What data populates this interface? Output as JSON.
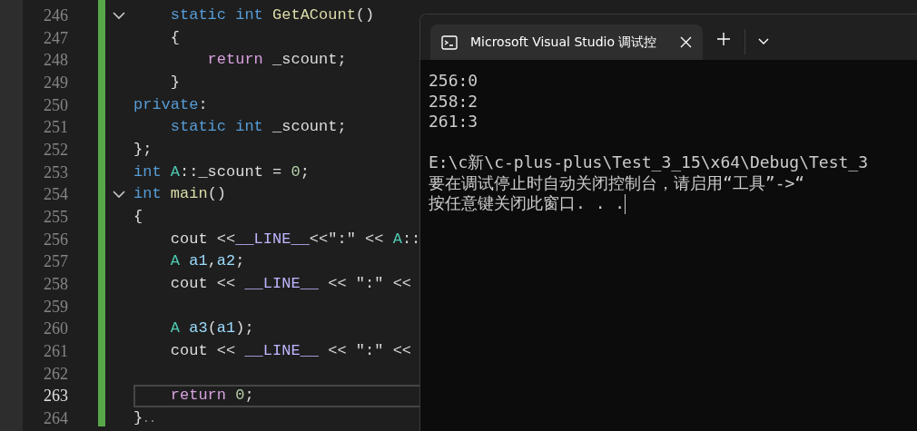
{
  "editor": {
    "lines": [
      {
        "number": "246",
        "current": false,
        "fold_toggle": true,
        "tokens": [
          {
            "kind": "keyword",
            "text": "    static int "
          },
          {
            "kind": "func",
            "text": "GetACount"
          },
          {
            "kind": "plain",
            "text": "()"
          }
        ]
      },
      {
        "number": "247",
        "current": false,
        "fold_toggle": false,
        "tokens": [
          {
            "kind": "plain",
            "text": "    {"
          }
        ]
      },
      {
        "number": "248",
        "current": false,
        "fold_toggle": false,
        "tokens": [
          {
            "kind": "control",
            "text": "        return"
          },
          {
            "kind": "plain",
            "text": " _scount;"
          }
        ]
      },
      {
        "number": "249",
        "current": false,
        "fold_toggle": false,
        "tokens": [
          {
            "kind": "plain",
            "text": "    }"
          }
        ]
      },
      {
        "number": "250",
        "current": false,
        "fold_toggle": false,
        "tokens": [
          {
            "kind": "keyword",
            "text": "private"
          },
          {
            "kind": "plain",
            "text": ":"
          }
        ]
      },
      {
        "number": "251",
        "current": false,
        "fold_toggle": false,
        "tokens": [
          {
            "kind": "keyword",
            "text": "    static int "
          },
          {
            "kind": "plain",
            "text": "_scount;"
          }
        ]
      },
      {
        "number": "252",
        "current": false,
        "fold_toggle": false,
        "tokens": [
          {
            "kind": "plain",
            "text": "};"
          }
        ]
      },
      {
        "number": "253",
        "current": false,
        "fold_toggle": false,
        "tokens": [
          {
            "kind": "keyword",
            "text": "int "
          },
          {
            "kind": "type",
            "text": "A"
          },
          {
            "kind": "plain",
            "text": "::_scount = "
          },
          {
            "kind": "number",
            "text": "0"
          },
          {
            "kind": "plain",
            "text": ";"
          }
        ]
      },
      {
        "number": "254",
        "current": false,
        "fold_toggle": true,
        "tokens": [
          {
            "kind": "keyword",
            "text": "int "
          },
          {
            "kind": "func",
            "text": "main"
          },
          {
            "kind": "plain",
            "text": "()"
          }
        ]
      },
      {
        "number": "255",
        "current": false,
        "fold_toggle": false,
        "tokens": [
          {
            "kind": "plain",
            "text": "{"
          }
        ]
      },
      {
        "number": "256",
        "current": false,
        "fold_toggle": false,
        "tokens": [
          {
            "kind": "plain",
            "text": "    cout <<"
          },
          {
            "kind": "macro",
            "text": "__LINE__"
          },
          {
            "kind": "plain",
            "text": "<<\":\" << "
          },
          {
            "kind": "type",
            "text": "A"
          },
          {
            "kind": "plain",
            "text": "::"
          }
        ]
      },
      {
        "number": "257",
        "current": false,
        "fold_toggle": false,
        "tokens": [
          {
            "kind": "type",
            "text": "    A "
          },
          {
            "kind": "variable",
            "text": "a1"
          },
          {
            "kind": "plain",
            "text": ","
          },
          {
            "kind": "variable",
            "text": "a2"
          },
          {
            "kind": "plain",
            "text": ";"
          }
        ]
      },
      {
        "number": "258",
        "current": false,
        "fold_toggle": false,
        "tokens": [
          {
            "kind": "plain",
            "text": "    cout << "
          },
          {
            "kind": "macro",
            "text": "__LINE__"
          },
          {
            "kind": "plain",
            "text": " << \":\" <<"
          }
        ]
      },
      {
        "number": "259",
        "current": false,
        "fold_toggle": false
      },
      {
        "number": "260",
        "current": false,
        "fold_toggle": false,
        "tokens": [
          {
            "kind": "type",
            "text": "    A "
          },
          {
            "kind": "variable",
            "text": "a3"
          },
          {
            "kind": "plain",
            "text": "("
          },
          {
            "kind": "variable",
            "text": "a1"
          },
          {
            "kind": "plain",
            "text": ");"
          }
        ]
      },
      {
        "number": "261",
        "current": false,
        "fold_toggle": false,
        "tokens": [
          {
            "kind": "plain",
            "text": "    cout << "
          },
          {
            "kind": "macro",
            "text": "__LINE__"
          },
          {
            "kind": "plain",
            "text": " << \":\" <<"
          }
        ]
      },
      {
        "number": "262",
        "current": false,
        "fold_toggle": false
      },
      {
        "number": "263",
        "current": true,
        "fold_toggle": false,
        "tokens": [
          {
            "kind": "control",
            "text": "    return"
          },
          {
            "kind": "number",
            "text": " 0"
          },
          {
            "kind": "plain",
            "text": ";"
          }
        ]
      },
      {
        "number": "264",
        "current": false,
        "fold_toggle": false,
        "tokens": [
          {
            "kind": "plain",
            "text": "}"
          },
          {
            "kind": "hint",
            "text": ".."
          }
        ]
      }
    ]
  },
  "console": {
    "tab": {
      "title": "Microsoft Visual Studio 调试控",
      "selected": true
    },
    "output": [
      "256:0",
      "258:2",
      "261:3"
    ],
    "messages": [
      "E:\\c新\\c-plus-plus\\Test_3_15\\x64\\Debug\\Test_3",
      "要在调试停止时自动关闭控制台，请启用“工具”->“",
      "按任意键关闭此窗口. . ."
    ]
  }
}
